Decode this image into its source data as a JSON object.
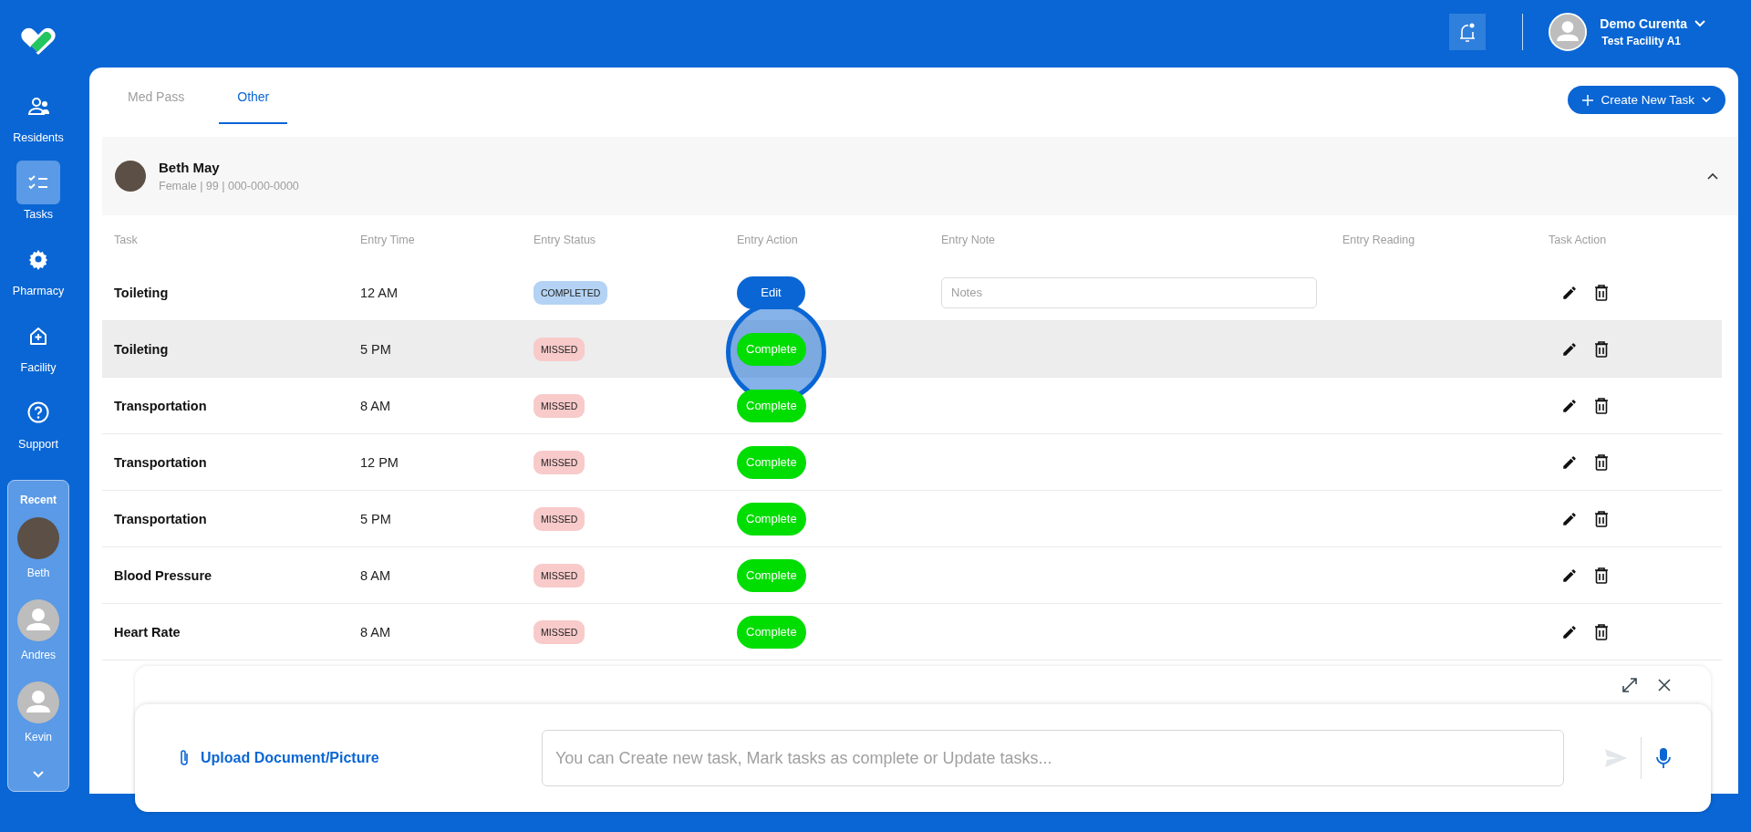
{
  "sidebar": {
    "items": [
      {
        "label": "Residents",
        "selected": false
      },
      {
        "label": "Tasks",
        "selected": true
      },
      {
        "label": "Pharmacy",
        "selected": false
      },
      {
        "label": "Facility",
        "selected": false
      },
      {
        "label": "Support",
        "selected": false
      }
    ],
    "recent": {
      "title": "Recent",
      "people": [
        {
          "name": "Beth",
          "kind": "photo"
        },
        {
          "name": "Andres",
          "kind": "avatar"
        },
        {
          "name": "Kevin",
          "kind": "avatar"
        }
      ]
    }
  },
  "header": {
    "user": {
      "name": "Demo Curenta",
      "facility": "Test Facility A1"
    }
  },
  "tabs": [
    {
      "label": "Med Pass",
      "selected": false
    },
    {
      "label": "Other",
      "selected": true
    }
  ],
  "create_button": {
    "label": "Create New Task"
  },
  "resident": {
    "name": "Beth May",
    "details": "Female | 99 | 000-000-0000",
    "expanded": true
  },
  "table": {
    "columns": [
      "Task",
      "Entry Time",
      "Entry Status",
      "Entry Action",
      "Entry Note",
      "Entry Reading",
      "Task Action"
    ],
    "rows": [
      {
        "task": "Toileting",
        "time": "12 AM",
        "status": "COMPLETED",
        "completed": true,
        "action": "Edit",
        "note_placeholder": "Notes",
        "selected": false,
        "clicked": false
      },
      {
        "task": "Toileting",
        "time": "5 PM",
        "status": "MISSED",
        "completed": false,
        "action": "Complete",
        "selected": true,
        "clicked": true
      },
      {
        "task": "Transportation",
        "time": "8 AM",
        "status": "MISSED",
        "completed": false,
        "action": "Complete",
        "selected": false,
        "clicked": false
      },
      {
        "task": "Transportation",
        "time": "12 PM",
        "status": "MISSED",
        "completed": false,
        "action": "Complete",
        "selected": false,
        "clicked": false
      },
      {
        "task": "Transportation",
        "time": "5 PM",
        "status": "MISSED",
        "completed": false,
        "action": "Complete",
        "selected": false,
        "clicked": false
      },
      {
        "task": "Blood Pressure",
        "time": "8 AM",
        "status": "MISSED",
        "completed": false,
        "action": "Complete",
        "selected": false,
        "clicked": false
      },
      {
        "task": "Heart Rate",
        "time": "8 AM",
        "status": "MISSED",
        "completed": false,
        "action": "Complete",
        "selected": false,
        "clicked": false
      }
    ]
  },
  "assistant": {
    "upload_label": "Upload Document/Picture",
    "placeholder": "You can Create new task, Mark tasks as complete or Update tasks..."
  }
}
